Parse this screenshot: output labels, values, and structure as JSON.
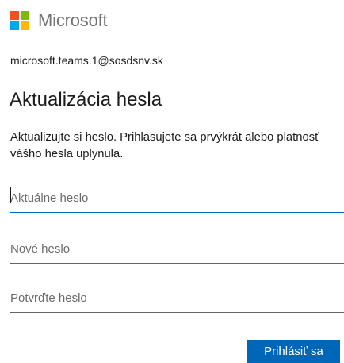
{
  "brand": {
    "name": "Microsoft",
    "colors": [
      "#f25022",
      "#7fba00",
      "#00a4ef",
      "#ffb900"
    ]
  },
  "account": "microsoft.teams.1@sosdsnv.sk",
  "title": "Aktualizácia hesla",
  "description": "Aktualizujte si heslo. Prihlasujete sa prvýkrát alebo platnosť vášho hesla uplynula.",
  "fields": {
    "current_password": {
      "placeholder": "Aktuálne heslo",
      "value": ""
    },
    "new_password": {
      "placeholder": "Nové heslo",
      "value": ""
    },
    "confirm_password": {
      "placeholder": "Potvrďte heslo",
      "value": ""
    }
  },
  "submit_label": "Prihlásiť sa",
  "accent_color": "#0067b8"
}
